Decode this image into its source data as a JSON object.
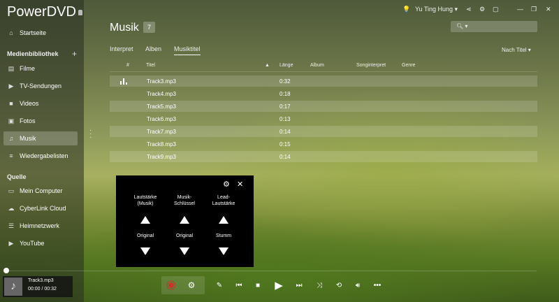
{
  "app": {
    "title": "PowerDVD"
  },
  "user": {
    "name": "Yu Ting Hung ▾"
  },
  "sidebar": {
    "home": "Startseite",
    "library_heading": "Medienbibliothek",
    "items": [
      {
        "label": "Filme",
        "icon": "film-icon"
      },
      {
        "label": "TV-Sendungen",
        "icon": "tv-icon"
      },
      {
        "label": "Videos",
        "icon": "video-icon"
      },
      {
        "label": "Fotos",
        "icon": "photo-icon"
      },
      {
        "label": "Musik",
        "icon": "music-icon"
      },
      {
        "label": "Wiedergabelisten",
        "icon": "playlist-icon"
      }
    ],
    "source_heading": "Quelle",
    "sources": [
      {
        "label": "Mein Computer",
        "icon": "computer-icon"
      },
      {
        "label": "CyberLink Cloud",
        "icon": "cloud-icon"
      },
      {
        "label": "Heimnetzwerk",
        "icon": "network-icon"
      },
      {
        "label": "YouTube",
        "icon": "youtube-icon"
      }
    ]
  },
  "main": {
    "title": "Musik",
    "count": "7",
    "tabs": [
      "Interpret",
      "Alben",
      "Musiktitel"
    ],
    "active_tab": "Musiktitel",
    "sort": "Nach Titel ▾",
    "search_placeholder": "",
    "columns": [
      "#",
      "Titel",
      "Länge",
      "Album",
      "Songinterpret",
      "Genre"
    ],
    "tracks": [
      {
        "title": "Track3.mp3",
        "length": "0:32",
        "playing": true
      },
      {
        "title": "Track4.mp3",
        "length": "0:18"
      },
      {
        "title": "Track5.mp3",
        "length": "0:17"
      },
      {
        "title": "Track6.mp3",
        "length": "0:13"
      },
      {
        "title": "Track7.mp3",
        "length": "0:14"
      },
      {
        "title": "Track8.mp3",
        "length": "0:15"
      },
      {
        "title": "Track9.mp3",
        "length": "0:14"
      }
    ]
  },
  "karaoke": {
    "col1_label_1": "Lautstärke",
    "col1_label_2": "(Musik)",
    "col2_label_1": "Musik-",
    "col2_label_2": "Schlüssel",
    "col3_label_1": "Lead-",
    "col3_label_2": "Lautstärke",
    "col1_value": "Original",
    "col2_value": "Original",
    "col3_value": "Stumm"
  },
  "player": {
    "track": "Track3.mp3",
    "time": "00:00  /  00:32",
    "progress_fraction": 0
  },
  "colors": {
    "accent": "#ffffff",
    "record": "#c0392b"
  }
}
